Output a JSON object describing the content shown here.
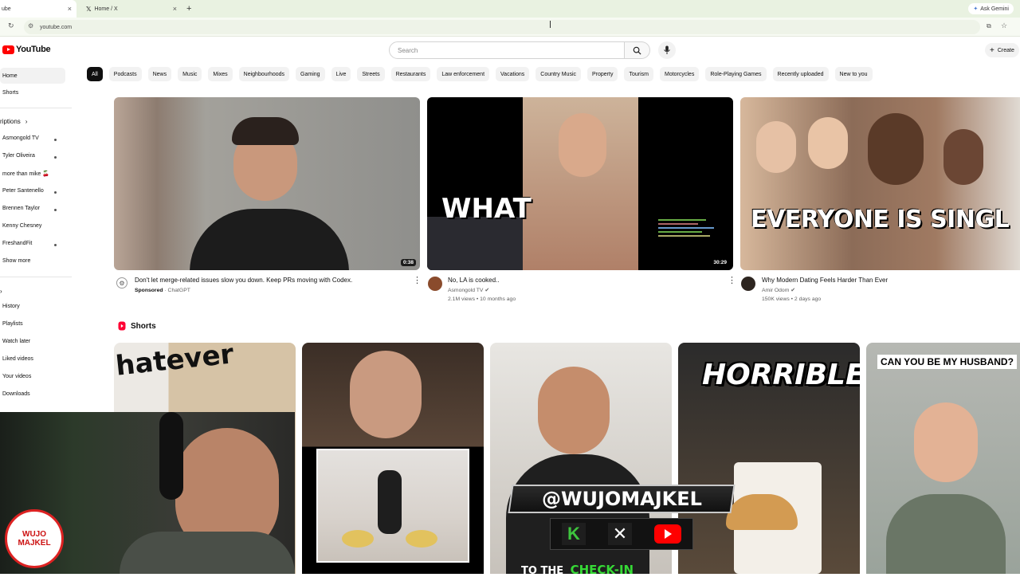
{
  "browser": {
    "tabs": [
      {
        "label": "ube",
        "active": true
      },
      {
        "label": "Home / X",
        "active": false
      }
    ],
    "new_tab": "+",
    "gemini": "Ask Gemini",
    "url": "youtube.com"
  },
  "header": {
    "logo": "YouTube",
    "search_placeholder": "Search",
    "create_label": "Create"
  },
  "chips": [
    "All",
    "Podcasts",
    "News",
    "Music",
    "Mixes",
    "Neighbourhoods",
    "Gaming",
    "Live",
    "Streets",
    "Restaurants",
    "Law enforcement",
    "Vacations",
    "Country Music",
    "Property",
    "Tourism",
    "Motorcycles",
    "Role-Playing Games",
    "Recently uploaded",
    "New to you"
  ],
  "sidebar": {
    "home": "Home",
    "shorts": "Shorts",
    "subscriptions": "riptions",
    "channels": [
      "Asmongold TV",
      "Tyler Oliveira",
      "more than mike 🍒",
      "Peter Santenello",
      "Brennen Taylor",
      "Kenny Chesney",
      "FreshandFit"
    ],
    "show_more": "Show more",
    "you_items": [
      "History",
      "Playlists",
      "Watch later",
      "Liked videos",
      "Your videos",
      "Downloads"
    ]
  },
  "videos": [
    {
      "title": "Don't let merge-related issues slow you down. Keep PRs moving with Codex.",
      "line1_sponsored": "Sponsored",
      "line1_channel": "ChatGPT",
      "line2": "",
      "duration": "0:38"
    },
    {
      "title": "No, LA is cooked..",
      "line1_channel": "Asmongold TV",
      "line2": "2.1M views • 10 months ago",
      "duration": "30:29",
      "thumb_text": "WHAT"
    },
    {
      "title": "Why Modern Dating Feels Harder Than Ever",
      "line1_channel": "Amir Odom",
      "line2": "150K views • 2 days ago",
      "thumb_text": "EVERYONE IS SINGL"
    }
  ],
  "shorts": {
    "label": "Shorts",
    "texts": [
      "hatever",
      "HORRIBLE",
      "CAN YOU BE MY HUSBAND?"
    ]
  },
  "overlay": {
    "handle": "@WUJOMAJKEL",
    "badge": "WUJO MAJKEL",
    "bottom_text_white": "TO THE",
    "bottom_text_green": "CHECK-IN"
  }
}
